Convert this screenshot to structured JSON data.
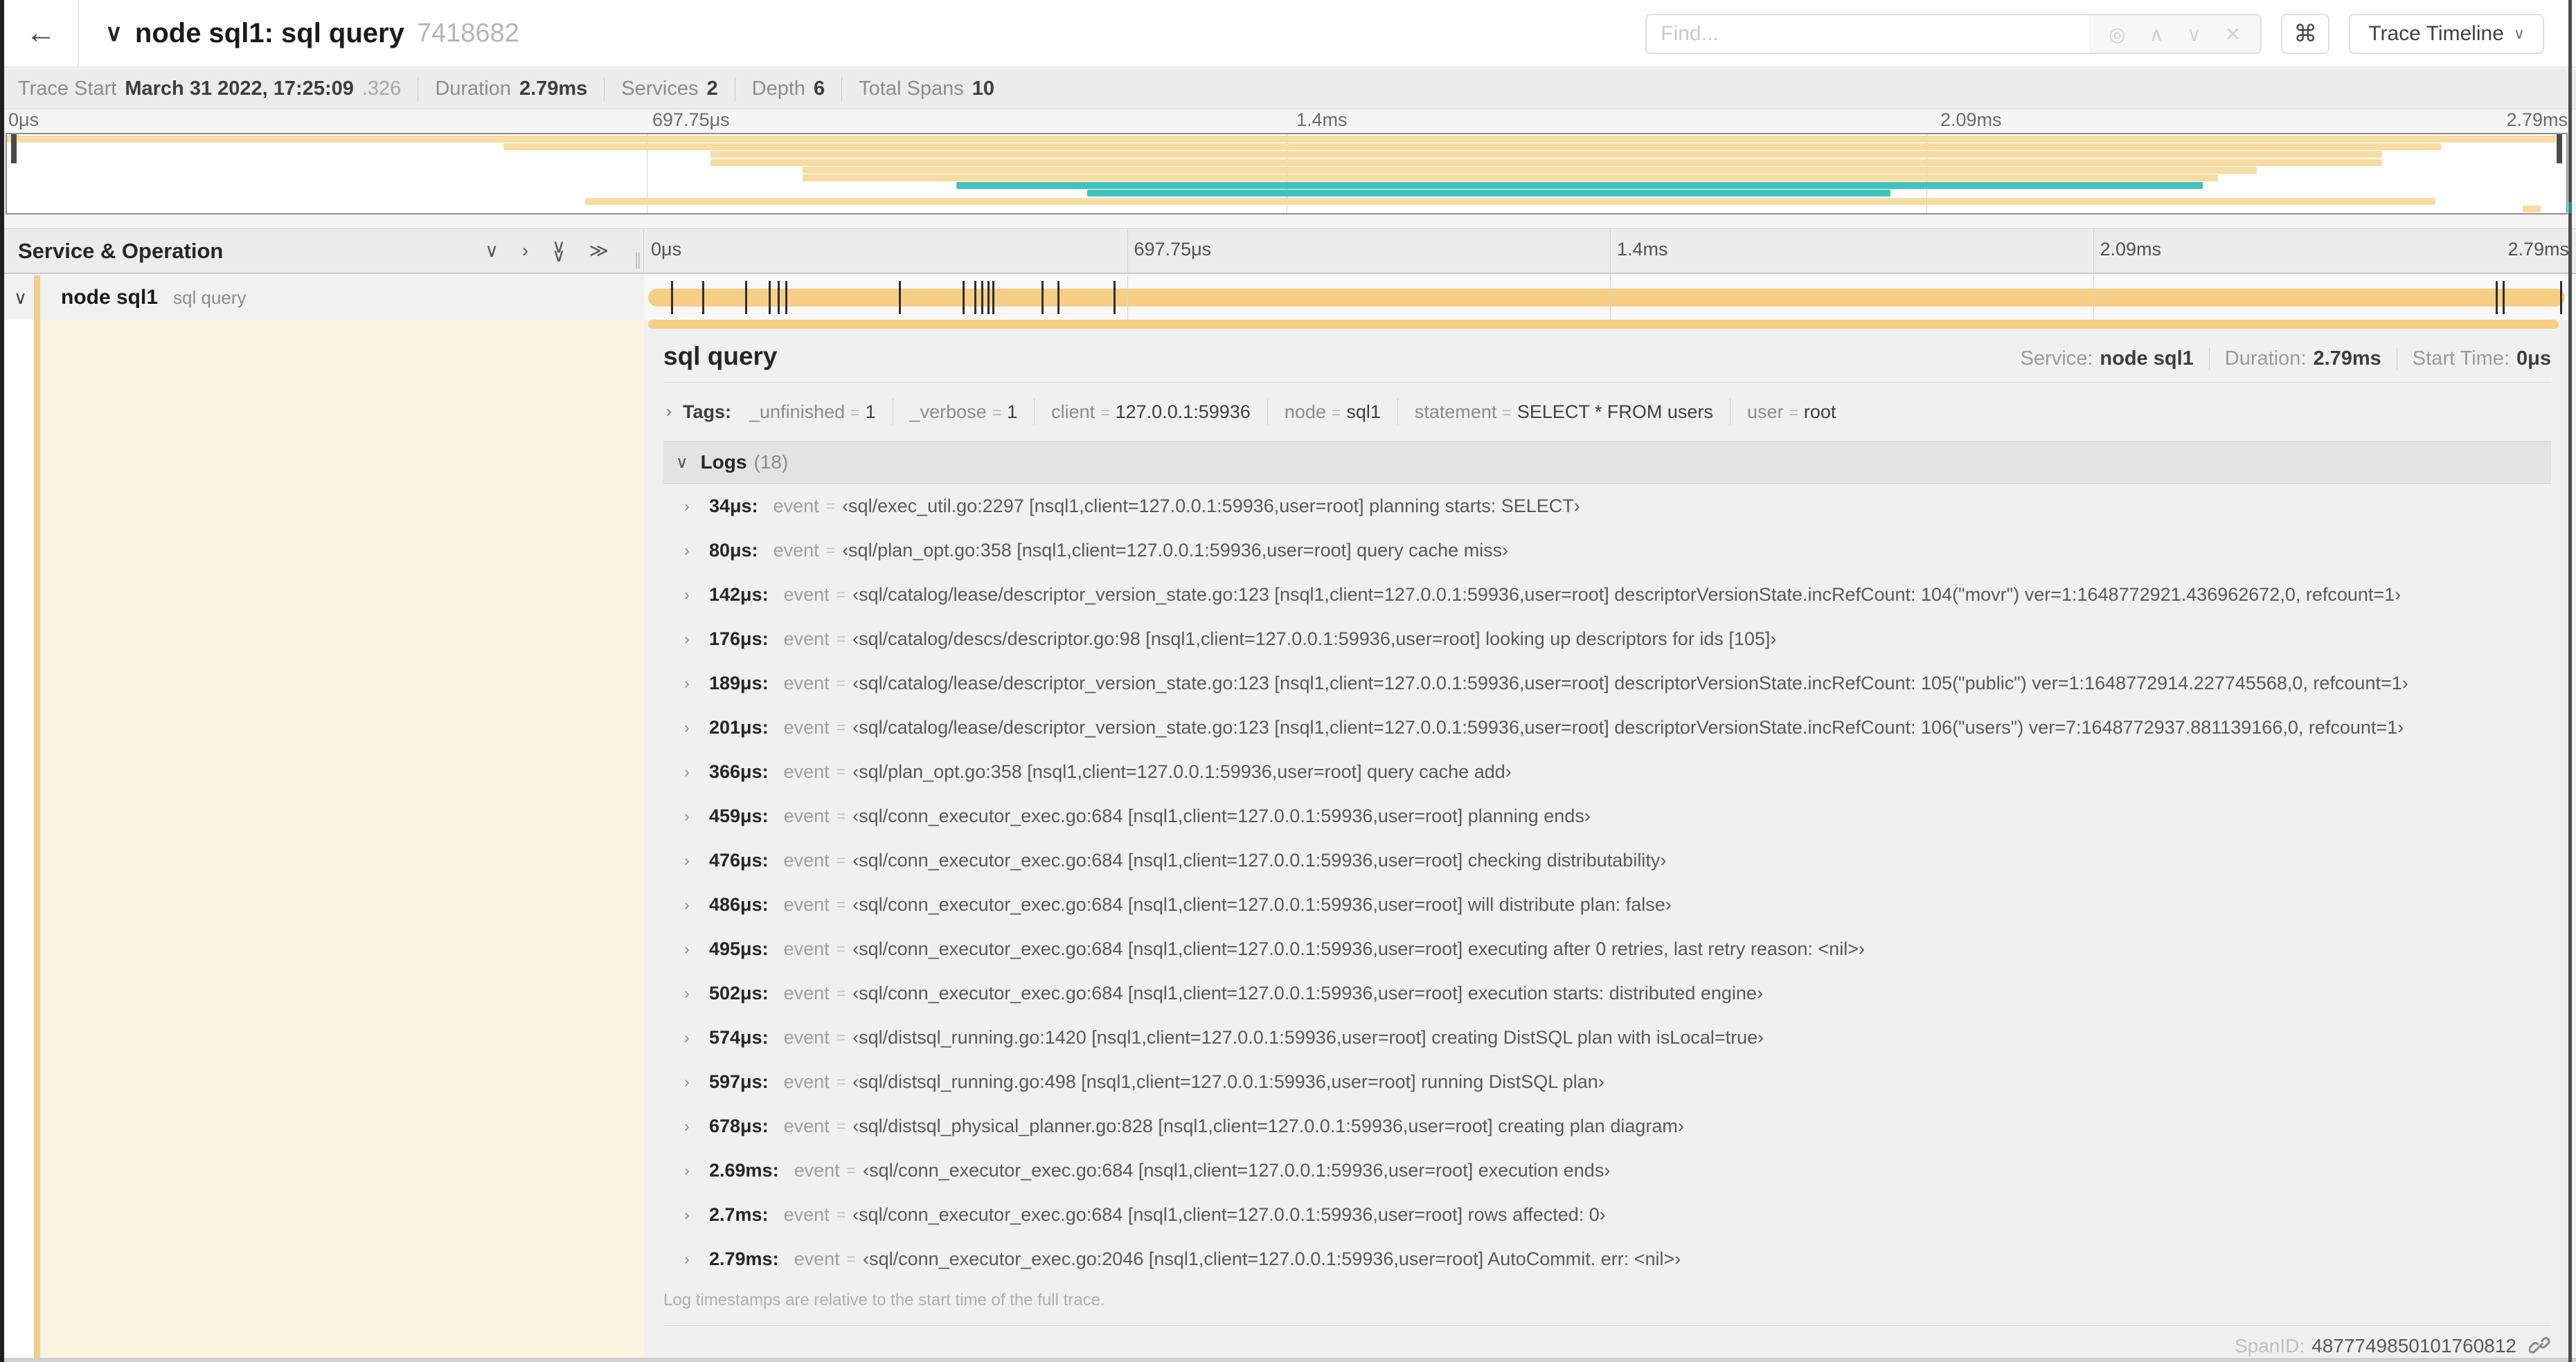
{
  "colors": {
    "tan_bar": "#F6CE85",
    "tan_minimap": "#F7DCA4",
    "teal": "#43C1BF",
    "tan_strip": "#F1CC8A",
    "cream": "#FBF3E1"
  },
  "icons": {
    "back": "←",
    "chevron_down": "∨",
    "chevron_right": "›",
    "chevron_up": "∧",
    "double_chevron_right": "≫",
    "target": "◎",
    "clear": "✕",
    "command": "⌘",
    "grip": "∥"
  },
  "header": {
    "title": "node sql1: sql query",
    "trace_id_suffix": "7418682",
    "find_placeholder": "Find...",
    "view_selector_label": "Trace Timeline"
  },
  "trace_meta": [
    {
      "label": "Trace Start",
      "value": "March 31 2022, 17:25:09",
      "suffix": ".326"
    },
    {
      "label": "Duration",
      "value": "2.79ms",
      "suffix": ""
    },
    {
      "label": "Services",
      "value": "2",
      "suffix": ""
    },
    {
      "label": "Depth",
      "value": "6",
      "suffix": ""
    },
    {
      "label": "Total Spans",
      "value": "10",
      "suffix": ""
    }
  ],
  "timeline": {
    "ruler_ticks": [
      "0μs",
      "697.75μs",
      "1.4ms",
      "2.09ms",
      "2.79ms"
    ],
    "duration_us": 2790,
    "minimap_spans": [
      {
        "start": 0,
        "end": 99.6,
        "color": "tan"
      },
      {
        "start": 19.4,
        "end": 95.1,
        "color": "tan"
      },
      {
        "start": 27.5,
        "end": 92.8,
        "color": "tan"
      },
      {
        "start": 27.5,
        "end": 92.8,
        "color": "tan"
      },
      {
        "start": 31.1,
        "end": 87.9,
        "color": "tan"
      },
      {
        "start": 31.1,
        "end": 86.4,
        "color": "tan"
      },
      {
        "start": 37.1,
        "end": 85.8,
        "color": "teal"
      },
      {
        "start": 42.2,
        "end": 73.6,
        "color": "teal"
      },
      {
        "start": 22.6,
        "end": 94.9,
        "color": "tan"
      },
      {
        "start": 98.3,
        "end": 99.0,
        "color": "tan"
      }
    ]
  },
  "span_table": {
    "header_title": "Service & Operation",
    "row": {
      "service": "node sql1",
      "operation": "sql query"
    }
  },
  "detail": {
    "title": "sql query",
    "meta": [
      {
        "label": "Service:",
        "value": "node sql1"
      },
      {
        "label": "Duration:",
        "value": "2.79ms"
      },
      {
        "label": "Start Time:",
        "value": "0μs"
      }
    ],
    "tags_label": "Tags:",
    "tags": [
      {
        "key": "_unfinished",
        "value": "1"
      },
      {
        "key": "_verbose",
        "value": "1"
      },
      {
        "key": "client",
        "value": "127.0.0.1:59936"
      },
      {
        "key": "node",
        "value": "sql1"
      },
      {
        "key": "statement",
        "value": "SELECT * FROM users"
      },
      {
        "key": "user",
        "value": "root"
      }
    ],
    "logs_label": "Logs",
    "logs_count": "(18)",
    "logs": [
      {
        "time": "34μs:",
        "t_us": 34,
        "key": "event",
        "value": "‹sql/exec_util.go:2297 [nsql1,client=127.0.0.1:59936,user=root] planning starts: SELECT›"
      },
      {
        "time": "80μs:",
        "t_us": 80,
        "key": "event",
        "value": "‹sql/plan_opt.go:358 [nsql1,client=127.0.0.1:59936,user=root] query cache miss›"
      },
      {
        "time": "142μs:",
        "t_us": 142,
        "key": "event",
        "value": "‹sql/catalog/lease/descriptor_version_state.go:123 [nsql1,client=127.0.0.1:59936,user=root] descriptorVersionState.incRefCount: 104(\"movr\") ver=1:1648772921.436962672,0, refcount=1›"
      },
      {
        "time": "176μs:",
        "t_us": 176,
        "key": "event",
        "value": "‹sql/catalog/descs/descriptor.go:98 [nsql1,client=127.0.0.1:59936,user=root] looking up descriptors for ids [105]›"
      },
      {
        "time": "189μs:",
        "t_us": 189,
        "key": "event",
        "value": "‹sql/catalog/lease/descriptor_version_state.go:123 [nsql1,client=127.0.0.1:59936,user=root] descriptorVersionState.incRefCount: 105(\"public\") ver=1:1648772914.227745568,0, refcount=1›"
      },
      {
        "time": "201μs:",
        "t_us": 201,
        "key": "event",
        "value": "‹sql/catalog/lease/descriptor_version_state.go:123 [nsql1,client=127.0.0.1:59936,user=root] descriptorVersionState.incRefCount: 106(\"users\") ver=7:1648772937.881139166,0, refcount=1›"
      },
      {
        "time": "366μs:",
        "t_us": 366,
        "key": "event",
        "value": "‹sql/plan_opt.go:358 [nsql1,client=127.0.0.1:59936,user=root] query cache add›"
      },
      {
        "time": "459μs:",
        "t_us": 459,
        "key": "event",
        "value": "‹sql/conn_executor_exec.go:684 [nsql1,client=127.0.0.1:59936,user=root] planning ends›"
      },
      {
        "time": "476μs:",
        "t_us": 476,
        "key": "event",
        "value": "‹sql/conn_executor_exec.go:684 [nsql1,client=127.0.0.1:59936,user=root] checking distributability›"
      },
      {
        "time": "486μs:",
        "t_us": 486,
        "key": "event",
        "value": "‹sql/conn_executor_exec.go:684 [nsql1,client=127.0.0.1:59936,user=root] will distribute plan: false›"
      },
      {
        "time": "495μs:",
        "t_us": 495,
        "key": "event",
        "value": "‹sql/conn_executor_exec.go:684 [nsql1,client=127.0.0.1:59936,user=root] executing after 0 retries, last retry reason: <nil>›"
      },
      {
        "time": "502μs:",
        "t_us": 502,
        "key": "event",
        "value": "‹sql/conn_executor_exec.go:684 [nsql1,client=127.0.0.1:59936,user=root] execution starts: distributed engine›"
      },
      {
        "time": "574μs:",
        "t_us": 574,
        "key": "event",
        "value": "‹sql/distsql_running.go:1420 [nsql1,client=127.0.0.1:59936,user=root] creating DistSQL plan with isLocal=true›"
      },
      {
        "time": "597μs:",
        "t_us": 597,
        "key": "event",
        "value": "‹sql/distsql_running.go:498 [nsql1,client=127.0.0.1:59936,user=root] running DistSQL plan›"
      },
      {
        "time": "678μs:",
        "t_us": 678,
        "key": "event",
        "value": "‹sql/distsql_physical_planner.go:828 [nsql1,client=127.0.0.1:59936,user=root] creating plan diagram›"
      },
      {
        "time": "2.69ms:",
        "t_us": 2690,
        "key": "event",
        "value": "‹sql/conn_executor_exec.go:684 [nsql1,client=127.0.0.1:59936,user=root] execution ends›"
      },
      {
        "time": "2.7ms:",
        "t_us": 2700,
        "key": "event",
        "value": "‹sql/conn_executor_exec.go:684 [nsql1,client=127.0.0.1:59936,user=root] rows affected: 0›"
      },
      {
        "time": "2.79ms:",
        "t_us": 2790,
        "key": "event",
        "value": "‹sql/conn_executor_exec.go:2046 [nsql1,client=127.0.0.1:59936,user=root] AutoCommit. err: <nil>›"
      }
    ],
    "logs_note": "Log timestamps are relative to the start time of the full trace.",
    "footer": {
      "label": "SpanID:",
      "value": "4877749850101760812"
    }
  }
}
